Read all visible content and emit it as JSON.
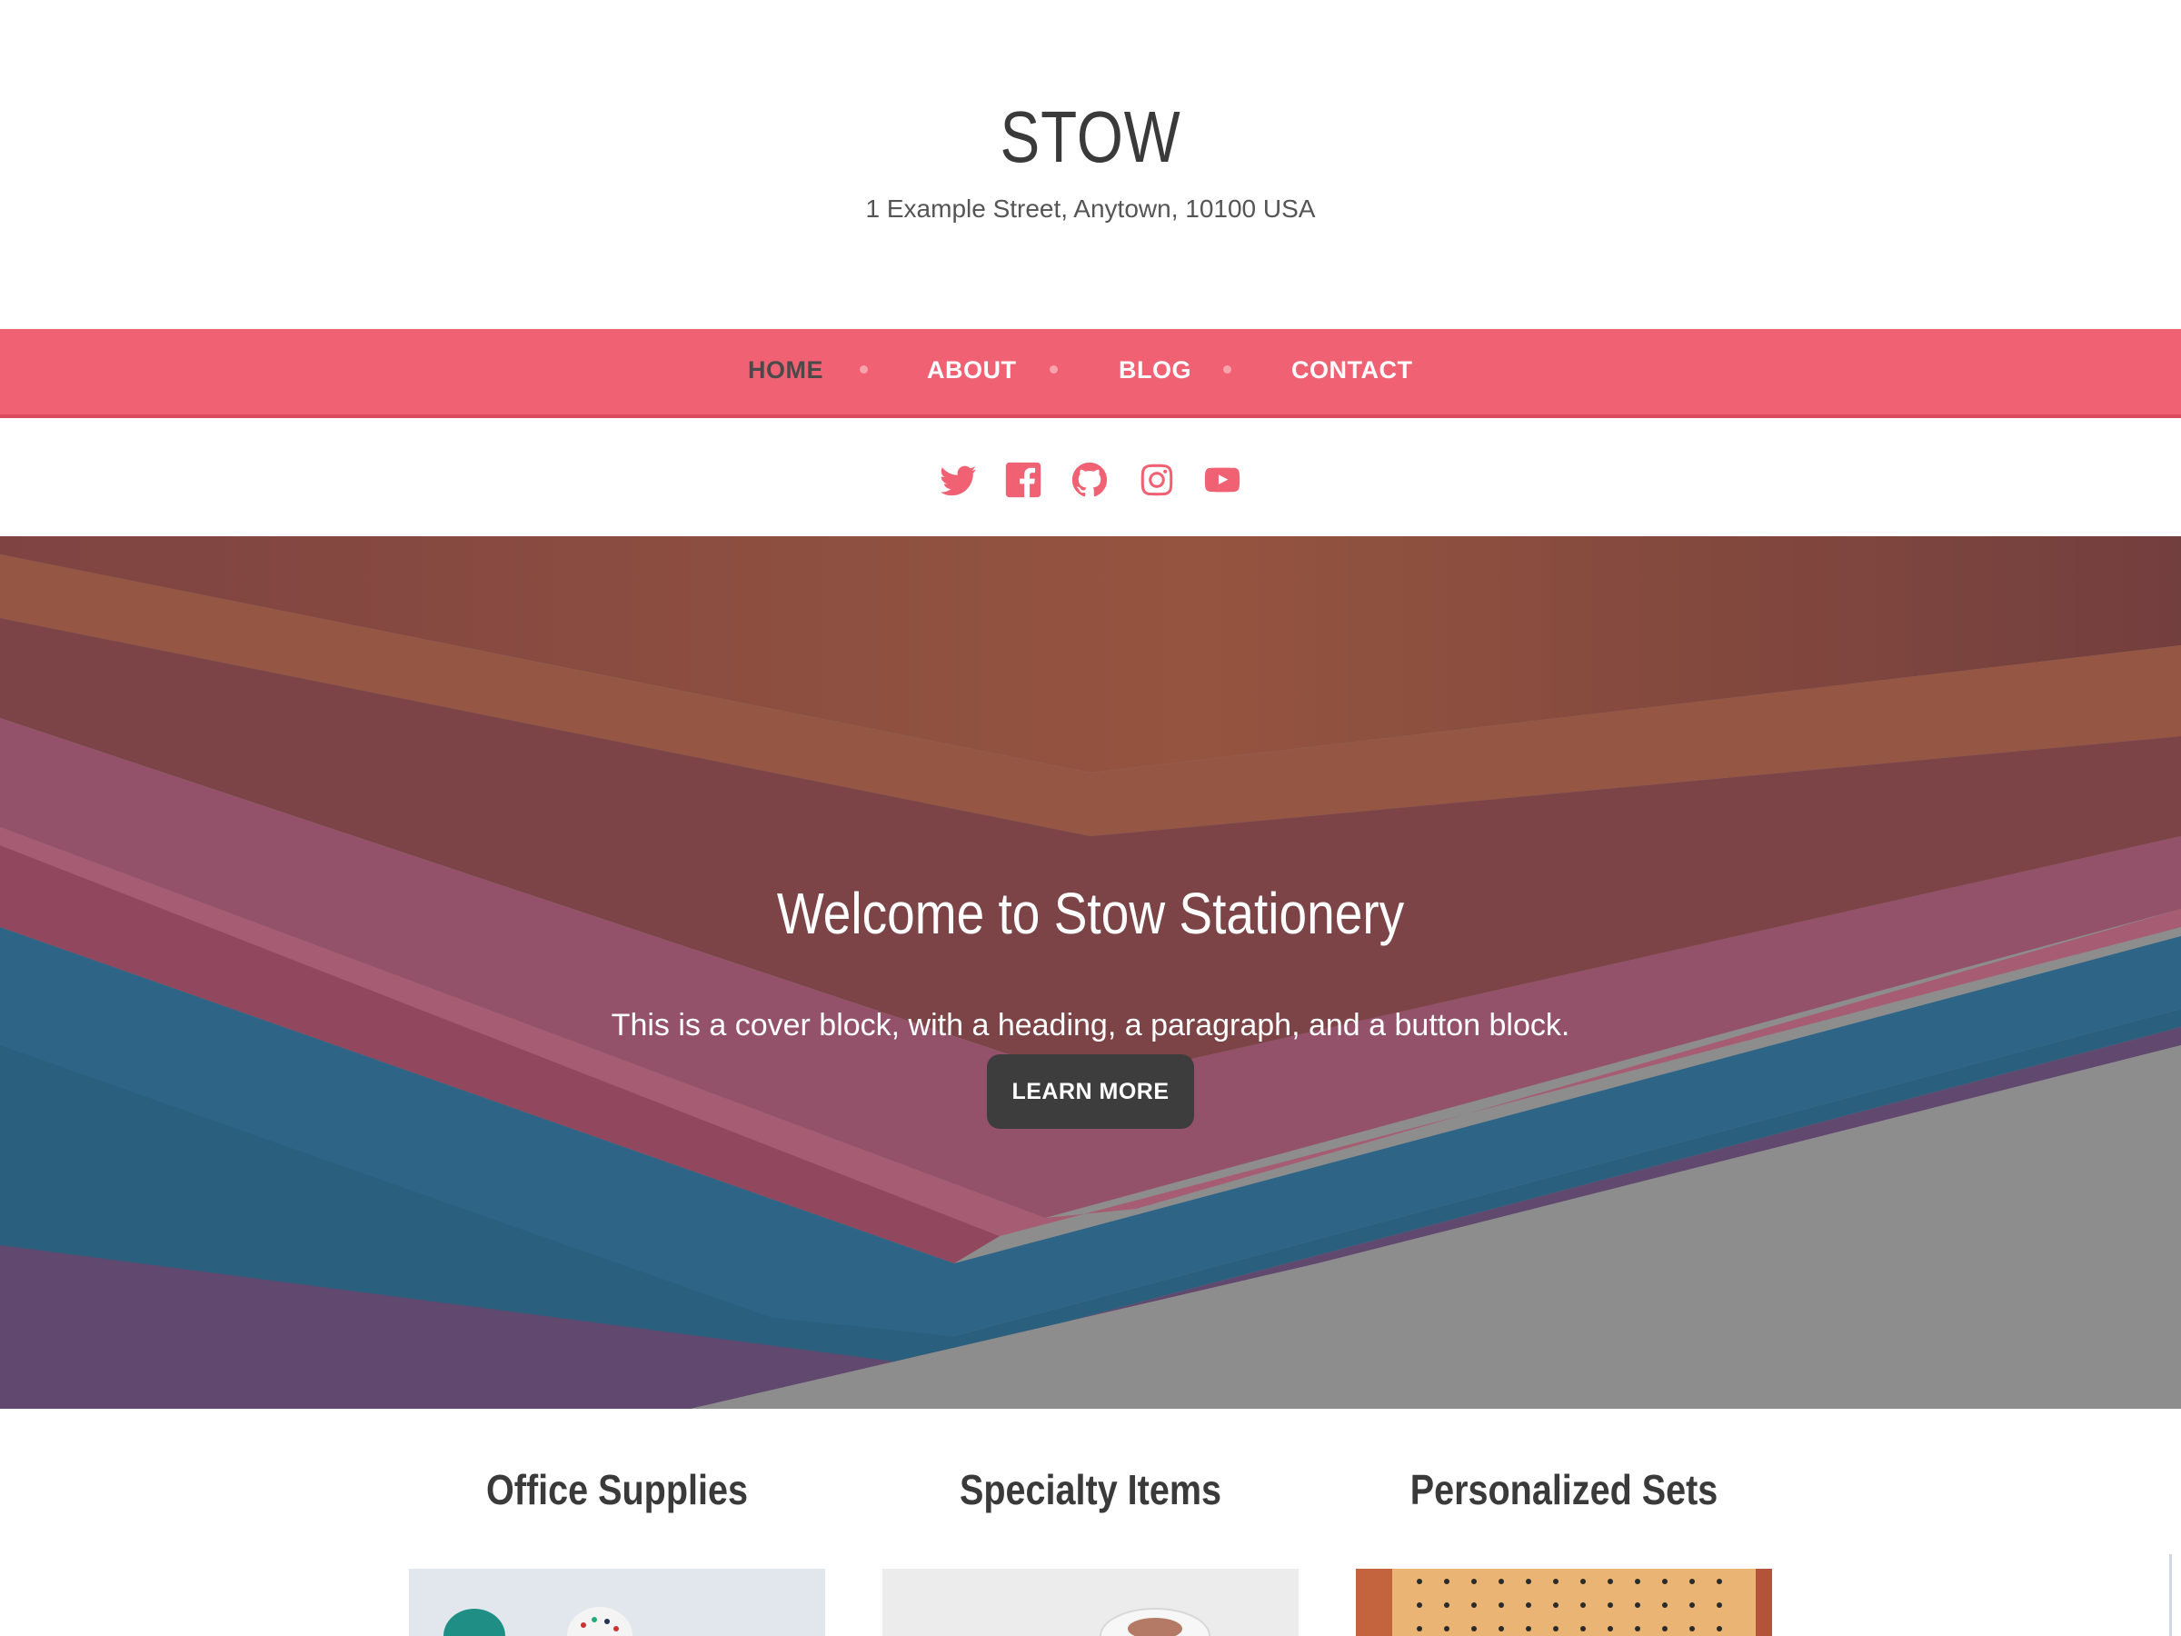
{
  "header": {
    "site_title": "STOW",
    "site_description": "1 Example Street, Anytown, 10100 USA"
  },
  "nav": {
    "items": [
      {
        "label": "HOME",
        "current": true
      },
      {
        "label": "ABOUT",
        "current": false
      },
      {
        "label": "BLOG",
        "current": false
      },
      {
        "label": "CONTACT",
        "current": false
      }
    ]
  },
  "social": {
    "icons": [
      "twitter-icon",
      "facebook-icon",
      "github-icon",
      "instagram-icon",
      "youtube-icon"
    ]
  },
  "cover": {
    "heading": "Welcome to Stow Stationery",
    "text": "This is a cover block, with a heading, a paragraph, and a button block.",
    "button_label": "LEARN MORE"
  },
  "columns": [
    {
      "title": "Office Supplies"
    },
    {
      "title": "Specialty Items"
    },
    {
      "title": "Personalized Sets"
    }
  ],
  "colors": {
    "accent": "#f06273",
    "nav_border": "#d94a5c",
    "text_dark": "#3a3a3a",
    "button_bg": "#3d3d3d"
  }
}
